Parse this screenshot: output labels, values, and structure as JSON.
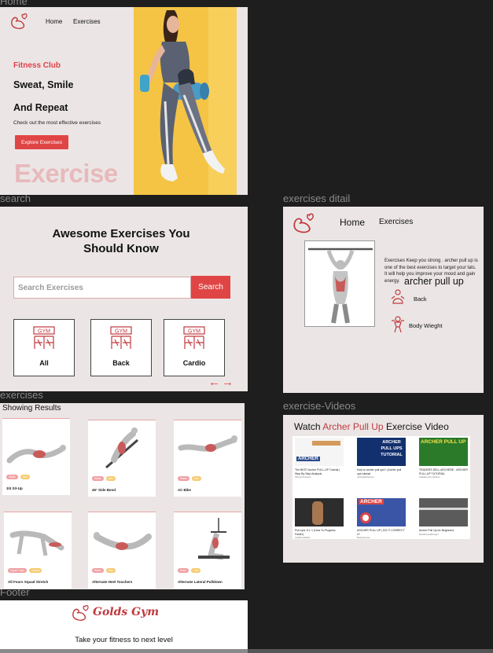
{
  "frames": {
    "home_label": "Home",
    "search_label": "search",
    "exercises_label": "exercises",
    "footer_label": "Footer",
    "detail_label": "exercises ditail",
    "videos_label": "exercise-Videos"
  },
  "home": {
    "nav": [
      "Home",
      "Exercises"
    ],
    "tag": "Fitness Club",
    "headline1": "Sweat, Smile",
    "headline2": "And Repeat",
    "subtitle": "Check out the most effective exercises",
    "button": "Explore Exercises",
    "big_text": "Exercise"
  },
  "search": {
    "title1": "Awesome Exercises You",
    "title2": "Should Know",
    "placeholder": "Search Exercises",
    "button": "Search",
    "categories": [
      "All",
      "Back",
      "Cardio"
    ],
    "icon_text": "GYM"
  },
  "exercises": {
    "heading": "Showing Results",
    "items": [
      {
        "name": "3/4 Sit-Up",
        "tags": [
          "Waist",
          "Abs"
        ]
      },
      {
        "name": "45° Side Bend",
        "tags": [
          "Waist",
          "Abs"
        ]
      },
      {
        "name": "Air Bike",
        "tags": [
          "Waist",
          "Abs"
        ]
      },
      {
        "name": "All Fours Squad Stretch",
        "tags": [
          "Upper Legs",
          "Quads"
        ]
      },
      {
        "name": "Alternate Heel Touchers",
        "tags": [
          "Waist",
          "Abs"
        ]
      },
      {
        "name": "Alternate Lateral Pulldown",
        "tags": [
          "Back",
          "Lats"
        ]
      }
    ]
  },
  "footer": {
    "brand": "Golds Gym",
    "tagline": "Take your fitness to next level"
  },
  "detail": {
    "nav": [
      "Home",
      "Exercises"
    ],
    "description": "Exercises Keep you strong . archer pull up is one of the best exercises to target your lats. It will help you improve your mood and gain energy.",
    "title": "archer pull up",
    "target": "Back",
    "equipment": "Body Wieght"
  },
  "videos": {
    "title_pre": "Watch ",
    "title_accent": "Archer Pull Up",
    "title_post": " Exercise Video",
    "items": [
      {
        "title": "The BEST Archer PULL-UP Tutorial | Step By Step Analysis",
        "channel": "FitnessTrainers",
        "thumb": "ARCHER",
        "colors": [
          "#f5f5f5",
          "#d39a5b"
        ]
      },
      {
        "title": "How to archer pull ups? | Archer pull ups tutorial",
        "channel": "JustCalisthenics",
        "thumb": "ARCHER PULL UPS TUTORIAL",
        "colors": [
          "#12306e",
          "#f4d24a"
        ]
      },
      {
        "title": "TRADERS DELL ARCHERE - ARCHER PULL-UP TUTORIAL",
        "channel": "Calisthenics Worker",
        "thumb": "ARCHER PULL UP",
        "colors": [
          "#2a7a2a",
          "#f8e14a"
        ]
      },
      {
        "title": "Pull-Ups 1/1: 1 (How To Progress Faster)",
        "channel": "CHRIS HERIA",
        "thumb": "",
        "colors": [
          "#2d2d2d",
          "#a77752"
        ]
      },
      {
        "title": "ARCHER PULL UP | DO IT CORRECT LY",
        "channel": "BodyFitness",
        "thumb": "ARCHER",
        "colors": [
          "#3a55a6",
          "#e04545"
        ]
      },
      {
        "title": "Archer Pull Up for Beginners",
        "channel": "ModFitnessProject",
        "thumb": "",
        "colors": [
          "#5b5b5b",
          "#d8d8d8"
        ]
      }
    ]
  },
  "colors": {
    "accent": "#e04545",
    "brand": "#c0393f",
    "panel": "#ebe6e5",
    "hero_bg": "#f5c445"
  }
}
